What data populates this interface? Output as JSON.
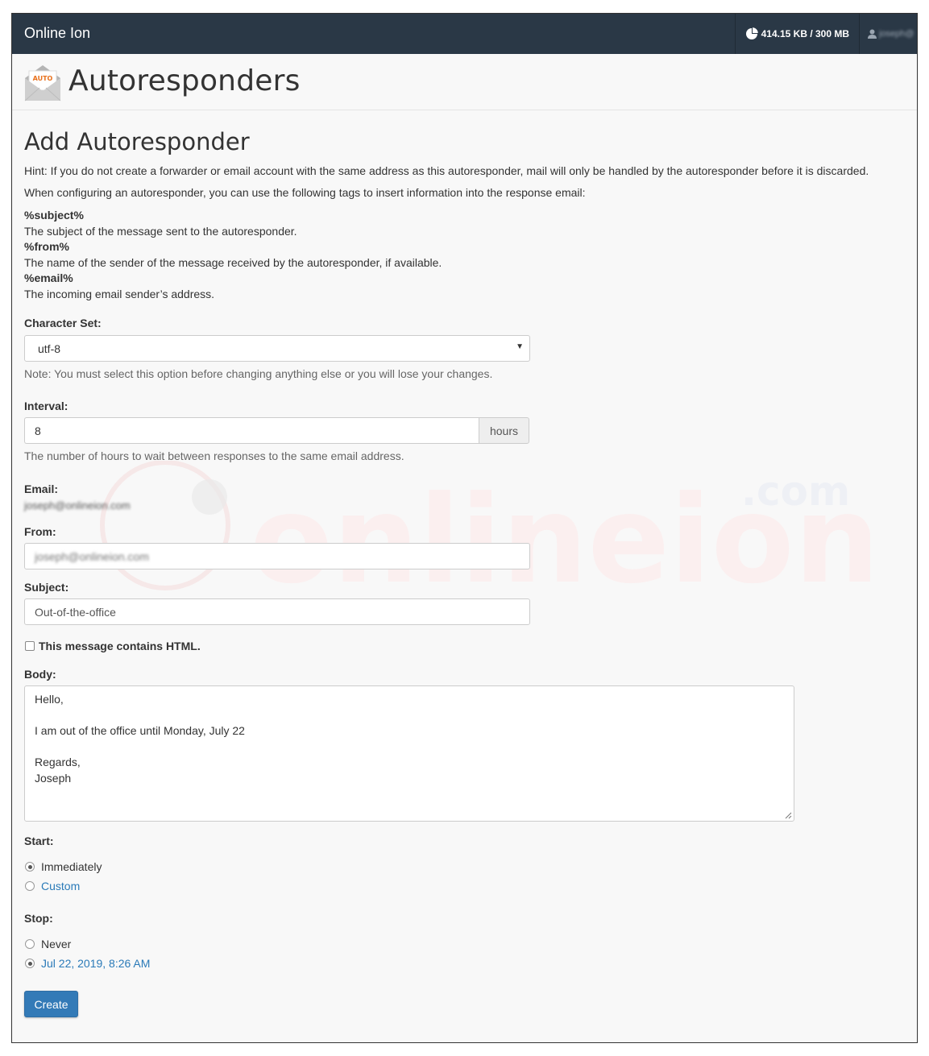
{
  "topbar": {
    "brand": "Online Ion",
    "quota": "414.15 KB / 300 MB",
    "username": "joseph@"
  },
  "header": {
    "title": "Autoresponders",
    "icon_label": "AUTO"
  },
  "form": {
    "section_title": "Add Autoresponder",
    "hint": "Hint: If you do not create a forwarder or email account with the same address as this autoresponder, mail will only be handled by the autoresponder before it is discarded.",
    "tags_intro": "When configuring an autoresponder, you can use the following tags to insert information into the response email:",
    "tags": [
      {
        "tag": "%subject%",
        "desc": "The subject of the message sent to the autoresponder."
      },
      {
        "tag": "%from%",
        "desc": "The name of the sender of the message received by the autoresponder, if available."
      },
      {
        "tag": "%email%",
        "desc": "The incoming email sender’s address."
      }
    ],
    "charset": {
      "label": "Character Set:",
      "value": "utf-8",
      "note": "Note: You must select this option before changing anything else or you will lose your changes."
    },
    "interval": {
      "label": "Interval:",
      "value": "8",
      "unit": "hours",
      "help": "The number of hours to wait between responses to the same email address."
    },
    "email": {
      "label": "Email:",
      "value": "joseph@onlineion.com"
    },
    "from": {
      "label": "From:",
      "value": "joseph@onlineion.com"
    },
    "subject": {
      "label": "Subject:",
      "value": "Out-of-the-office"
    },
    "html_checkbox": {
      "label": "This message contains HTML.",
      "checked": false
    },
    "body": {
      "label": "Body:",
      "lines": [
        "Hello,",
        "",
        "I am out of the office until Monday, July 22",
        "",
        "Regards,",
        "Joseph"
      ]
    },
    "start": {
      "label": "Start:",
      "options": [
        {
          "label": "Immediately",
          "checked": true
        },
        {
          "label": "Custom",
          "checked": false
        }
      ]
    },
    "stop": {
      "label": "Stop:",
      "options": [
        {
          "label": "Never",
          "checked": false
        },
        {
          "label": "Jul 22, 2019, 8:26 AM",
          "checked": true
        }
      ]
    },
    "submit_label": "Create"
  },
  "watermark": {
    "text_main": "onlineion",
    "text_tld": ".com"
  },
  "colors": {
    "topbar": "#2a3846",
    "primary": "#337ab7",
    "link": "#2a7ab8"
  }
}
